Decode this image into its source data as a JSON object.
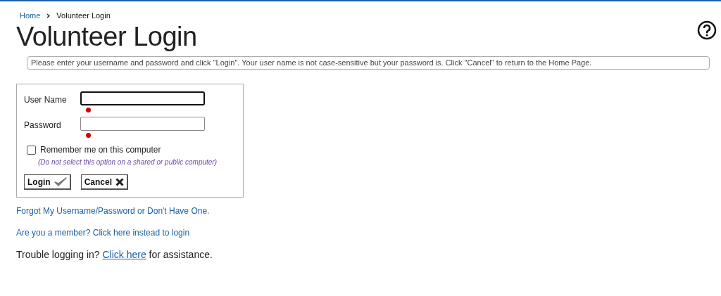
{
  "breadcrumb": [
    {
      "label": "Home",
      "current": false
    },
    {
      "label": "Volunteer Login",
      "current": true
    }
  ],
  "title": "Volunteer Login",
  "instructions": "Please enter your username and password and click \"Login\". Your user name is not case-sensitive but your password is. Click \"Cancel\" to return to the Home Page.",
  "fields": [
    {
      "label": "User Name",
      "focused": true,
      "required": true
    },
    {
      "label": "Password",
      "focused": false,
      "required": true
    }
  ],
  "remember": {
    "label": "Remember me on this computer",
    "checked": false,
    "note": "(Do not select this option on a shared or public computer)"
  },
  "buttons": [
    {
      "label": "Login",
      "kind": "check"
    },
    {
      "label": "Cancel",
      "kind": "cross"
    }
  ],
  "links": [
    "Forgot My Username/Password or Don't Have One.",
    "Are you a member? Click here instead to login"
  ],
  "trouble": {
    "before": "Trouble logging in?",
    "link": "Click here",
    "after": "for assistance."
  }
}
